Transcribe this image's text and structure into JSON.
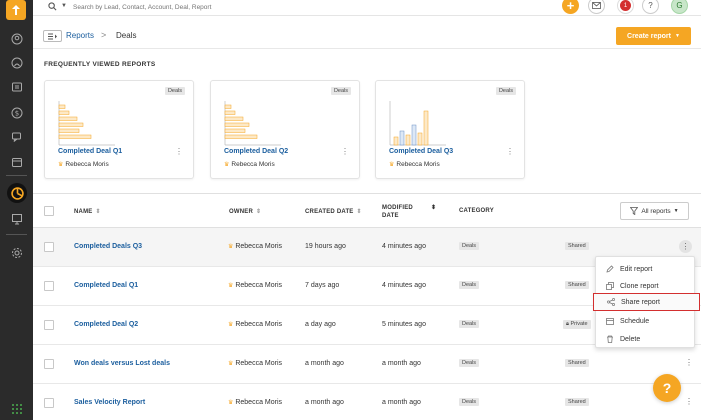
{
  "topbar": {
    "search_placeholder": "Search by Lead, Contact, Account, Deal, Report",
    "notification_count": "1",
    "help_label": "?",
    "avatar_initial": "G",
    "plus_label": "+"
  },
  "breadcrumb": {
    "parent": "Reports",
    "separator": ">",
    "current": "Deals"
  },
  "create_button": "Create report",
  "frequently_viewed": {
    "title": "FREQUENTLY VIEWED REPORTS",
    "cards": [
      {
        "tag": "Deals",
        "title": "Completed Deal Q1",
        "owner": "Rebecca Moris"
      },
      {
        "tag": "Deals",
        "title": "Completed Deal Q2",
        "owner": "Rebecca Moris"
      },
      {
        "tag": "Deals",
        "title": "Completed Deal Q3",
        "owner": "Rebecca Moris"
      }
    ]
  },
  "table": {
    "headers": {
      "name": "NAME",
      "owner": "OWNER",
      "created": "CREATED DATE",
      "modified_line1": "MODIFIED",
      "modified_line2": "DATE",
      "category": "CATEGORY"
    },
    "filter_label": "All reports",
    "rows": [
      {
        "name": "Completed Deals Q3",
        "owner": "Rebecca Moris",
        "created": "19 hours ago",
        "modified": "4 minutes ago",
        "category": "Deals",
        "visibility": "Shared"
      },
      {
        "name": "Completed Deal Q1",
        "owner": "Rebecca Moris",
        "created": "7 days ago",
        "modified": "4 minutes ago",
        "category": "Deals",
        "visibility": "Shared"
      },
      {
        "name": "Completed Deal Q2",
        "owner": "Rebecca Moris",
        "created": "a day ago",
        "modified": "5 minutes ago",
        "category": "Deals",
        "visibility": "Private"
      },
      {
        "name": "Won deals versus Lost deals",
        "owner": "Rebecca Moris",
        "created": "a month ago",
        "modified": "a month ago",
        "category": "Deals",
        "visibility": "Shared"
      },
      {
        "name": "Sales Velocity Report",
        "owner": "Rebecca Moris",
        "created": "a month ago",
        "modified": "a month ago",
        "category": "Deals",
        "visibility": "Shared"
      }
    ]
  },
  "context_menu": {
    "items": [
      "Edit report",
      "Clone report",
      "Share report",
      "Schedule",
      "Delete"
    ]
  },
  "help_fab": "?",
  "colors": {
    "accent": "#f5a623",
    "link": "#1b5e9e",
    "rail": "#2b2b2b",
    "highlight_border": "#d32f2f"
  }
}
